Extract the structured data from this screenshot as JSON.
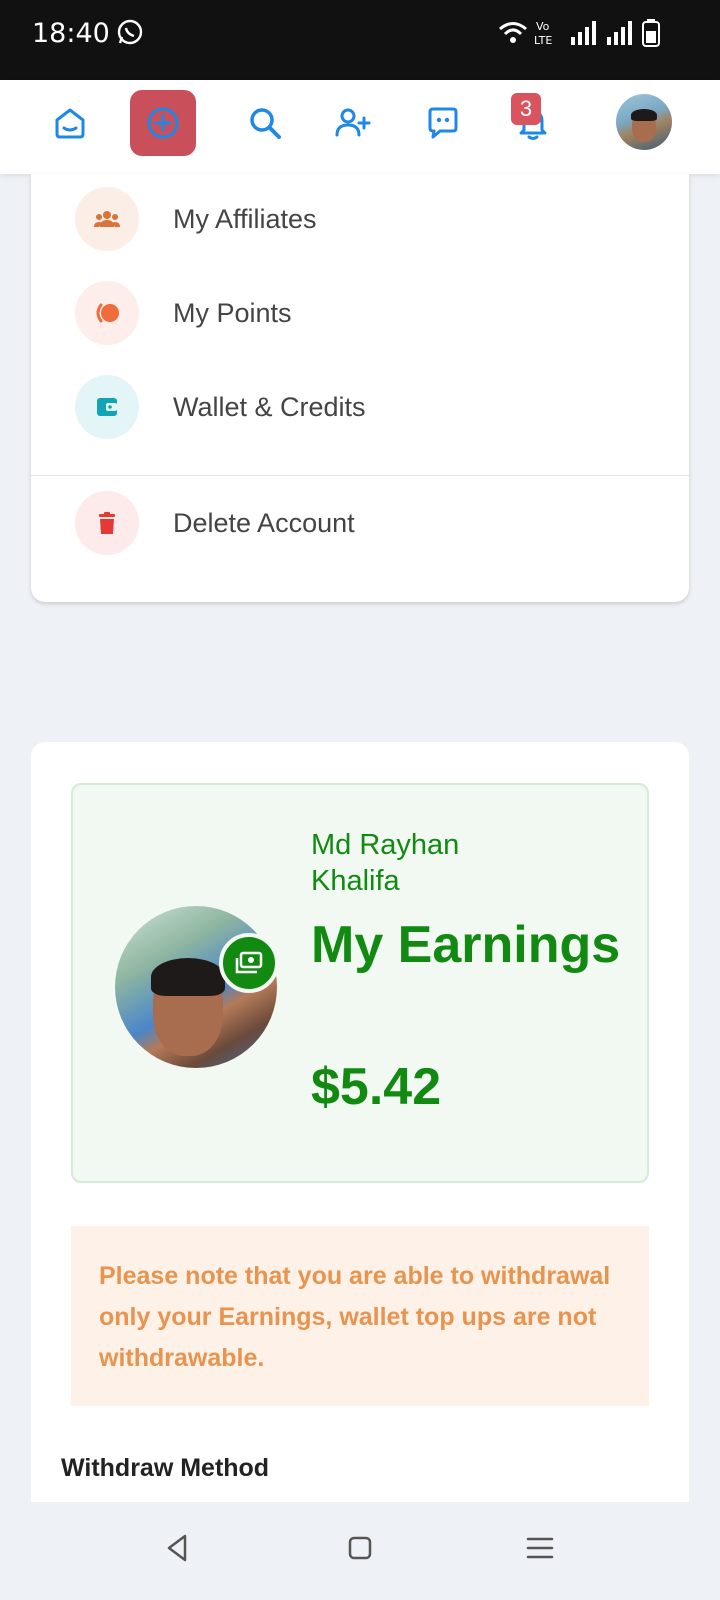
{
  "status_bar": {
    "time": "18:40",
    "icons": [
      "whatsapp-icon",
      "wifi-icon",
      "volte-icon",
      "signal-icon",
      "signal-icon",
      "battery-icon"
    ]
  },
  "top_nav": {
    "items": [
      "home-icon",
      "create-post-icon",
      "search-icon",
      "add-friend-icon",
      "messages-icon",
      "notifications-icon",
      "avatar"
    ],
    "notification_count": "3",
    "accent_color": "#1e88e5",
    "create_bg_color": "#c9505b"
  },
  "menu": {
    "items": [
      {
        "label": "My Affiliates",
        "icon": "users-icon",
        "icon_color": "#d9733a",
        "bg_color": "#fbeee6"
      },
      {
        "label": "My Points",
        "icon": "points-icon",
        "icon_color": "#f26b3a",
        "bg_color": "#fdeeec"
      },
      {
        "label": "Wallet & Credits",
        "icon": "wallet-icon",
        "icon_color": "#11a4b5",
        "bg_color": "#e4f5f7"
      },
      {
        "label": "Delete Account",
        "icon": "trash-icon",
        "icon_color": "#e53935",
        "bg_color": "#fdeaea"
      }
    ]
  },
  "earnings": {
    "user_name": "Md Rayhan Khalifa",
    "title": "My Earnings",
    "amount": "$5.42",
    "badge_icon": "money-icon",
    "color": "#128a12"
  },
  "notice": {
    "text": "Please note that you are able to withdrawal only your Earnings, wallet top ups are not withdrawable."
  },
  "withdraw": {
    "label": "Withdraw Method"
  },
  "bottom_nav": {
    "items": [
      "back-icon",
      "home-square-icon",
      "menu-icon"
    ]
  }
}
